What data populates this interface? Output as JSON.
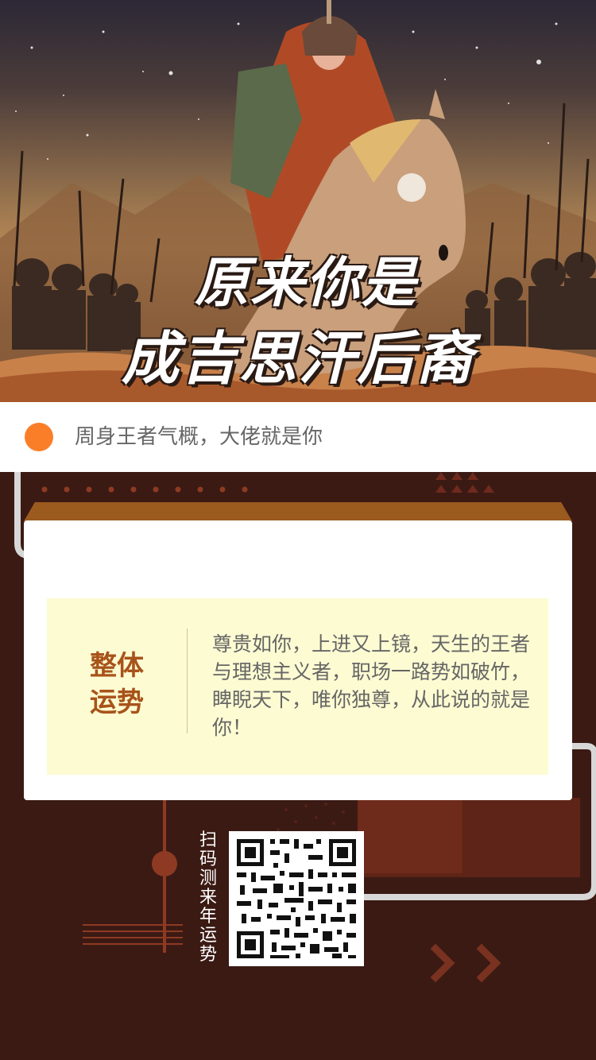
{
  "hero": {
    "title_line1": "原来你是",
    "title_line2": "成吉思汗后裔"
  },
  "subtitle": {
    "text": "周身王者气概，大佬就是你",
    "dot_color": "#fa7e28"
  },
  "fortune": {
    "label": "整体运势",
    "text": "尊贵如你，上进又上镜，天生的王者与理想主义者，职场一路势如破竹，睥睨天下，唯你独尊，从此说的就是你！"
  },
  "qr": {
    "caption": "扫码测来年运势",
    "icon": "qr-code-icon"
  },
  "colors": {
    "background": "#3b1a14",
    "accent": "#a8531a",
    "fortune_bg": "#fdfbd2"
  }
}
